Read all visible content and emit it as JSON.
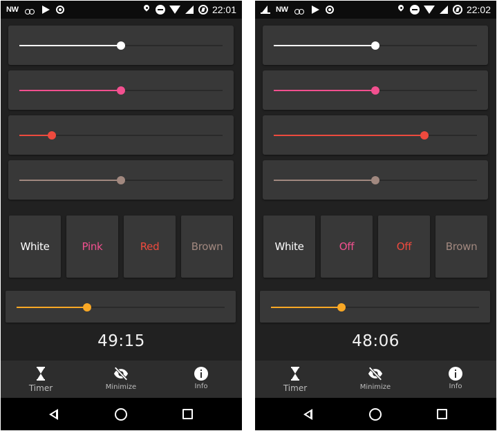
{
  "colors": {
    "white": "#ffffff",
    "pink": "#f2508f",
    "red": "#ee4a3e",
    "brown": "#a1887f",
    "amber": "#f9a825",
    "panel": "#383838",
    "background": "#212121"
  },
  "screens": [
    {
      "status": {
        "carrier": "NW",
        "left_icons": [
          "cloud-download-icon",
          "play-store-icon",
          "target-icon"
        ],
        "right_icons": [
          "location-icon",
          "do-not-disturb-icon",
          "wifi-icon",
          "signal-icon",
          "battery-charging-icon"
        ],
        "time": "22:01"
      },
      "sliders": [
        {
          "name": "white",
          "color": "#ffffff",
          "level": 0.5
        },
        {
          "name": "pink",
          "color": "#f2508f",
          "level": 0.5
        },
        {
          "name": "red",
          "color": "#ee4a3e",
          "level": 0.16
        },
        {
          "name": "brown",
          "color": "#a1887f",
          "level": 0.5
        }
      ],
      "buttons": [
        {
          "label": "White",
          "color": "#ffffff"
        },
        {
          "label": "Pink",
          "color": "#f2508f"
        },
        {
          "label": "Red",
          "color": "#ee4a3e"
        },
        {
          "label": "Brown",
          "color": "#a1887f"
        }
      ],
      "timer_level": 0.34,
      "countdown": "49:15"
    },
    {
      "status": {
        "carrier": "NW",
        "left_icons": [
          "sailboat-icon",
          "cloud-download-icon",
          "play-store-icon",
          "target-icon"
        ],
        "right_icons": [
          "location-icon",
          "do-not-disturb-icon",
          "wifi-icon",
          "signal-icon",
          "battery-charging-icon"
        ],
        "time": "22:02"
      },
      "sliders": [
        {
          "name": "white",
          "color": "#ffffff",
          "level": 0.5
        },
        {
          "name": "pink",
          "color": "#f2508f",
          "level": 0.5
        },
        {
          "name": "red",
          "color": "#ee4a3e",
          "level": 0.74
        },
        {
          "name": "brown",
          "color": "#a1887f",
          "level": 0.5
        }
      ],
      "buttons": [
        {
          "label": "White",
          "color": "#ffffff"
        },
        {
          "label": "Off",
          "color": "#f2508f"
        },
        {
          "label": "Off",
          "color": "#ee4a3e"
        },
        {
          "label": "Brown",
          "color": "#a1887f"
        }
      ],
      "timer_level": 0.34,
      "countdown": "48:06"
    }
  ],
  "nav": {
    "timer": {
      "label": "Timer",
      "icon": "hourglass-icon"
    },
    "minimize": {
      "label": "Minimize",
      "icon": "eye-off-icon"
    },
    "info": {
      "label": "Info",
      "icon": "info-icon"
    }
  },
  "system_nav": {
    "back": "back-icon",
    "home": "home-icon",
    "recents": "recents-icon"
  }
}
